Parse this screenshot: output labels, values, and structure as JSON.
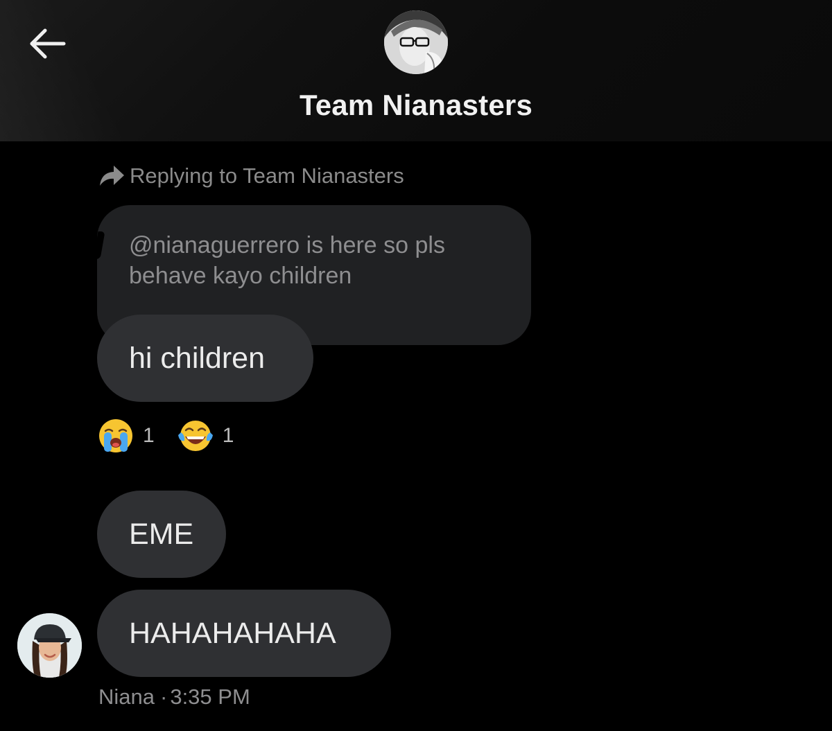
{
  "header": {
    "back_icon": "arrow-left-icon",
    "title": "Team Nianasters",
    "avatar_alt": "group-avatar"
  },
  "reply": {
    "icon": "reply-arrow-icon",
    "text": "Replying to Team Nianasters"
  },
  "quoted_message": {
    "line1": "@nianaguerrero is here so pls",
    "line2": "behave kayo children"
  },
  "messages": [
    {
      "text": "hi children"
    },
    {
      "text": "EME"
    },
    {
      "text": "HAHAHAHAHA"
    }
  ],
  "reactions": [
    {
      "icon": "loudly-crying-face-emoji",
      "count": "1"
    },
    {
      "icon": "face-with-tears-of-joy-emoji",
      "count": "1"
    }
  ],
  "meta": {
    "sender": "Niana",
    "separator": "·",
    "time": "3:35 PM"
  },
  "colors": {
    "background": "#000000",
    "bubble": "#2f3033",
    "quoted_bubble": "#202123",
    "muted_text": "#8e8e90"
  }
}
